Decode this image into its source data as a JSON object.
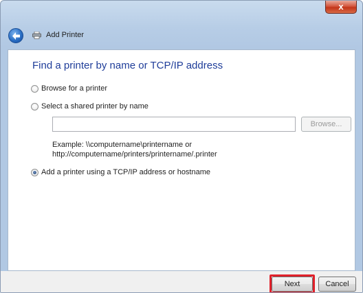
{
  "window": {
    "title": "Add Printer",
    "close_glyph": "x"
  },
  "heading": "Find a printer by name or TCP/IP address",
  "options": {
    "browse": {
      "label": "Browse for a printer",
      "selected": false
    },
    "shared": {
      "label": "Select a shared printer by name",
      "selected": false
    },
    "tcpip": {
      "label": "Add a printer using a TCP/IP address or hostname",
      "selected": true
    }
  },
  "shared_name_input": {
    "value": ""
  },
  "browse_button": {
    "label": "Browse...",
    "enabled": false
  },
  "example": {
    "line1": "Example: \\\\computername\\printername or",
    "line2": "http://computername/printers/printername/.printer"
  },
  "footer": {
    "next_label": "Next",
    "cancel_label": "Cancel"
  },
  "colors": {
    "heading": "#1f3d99",
    "highlight": "#e0202a",
    "chrome": "#b7cde6"
  },
  "icons": {
    "back": "back-arrow-icon",
    "printer": "printer-icon",
    "close": "close-icon"
  }
}
